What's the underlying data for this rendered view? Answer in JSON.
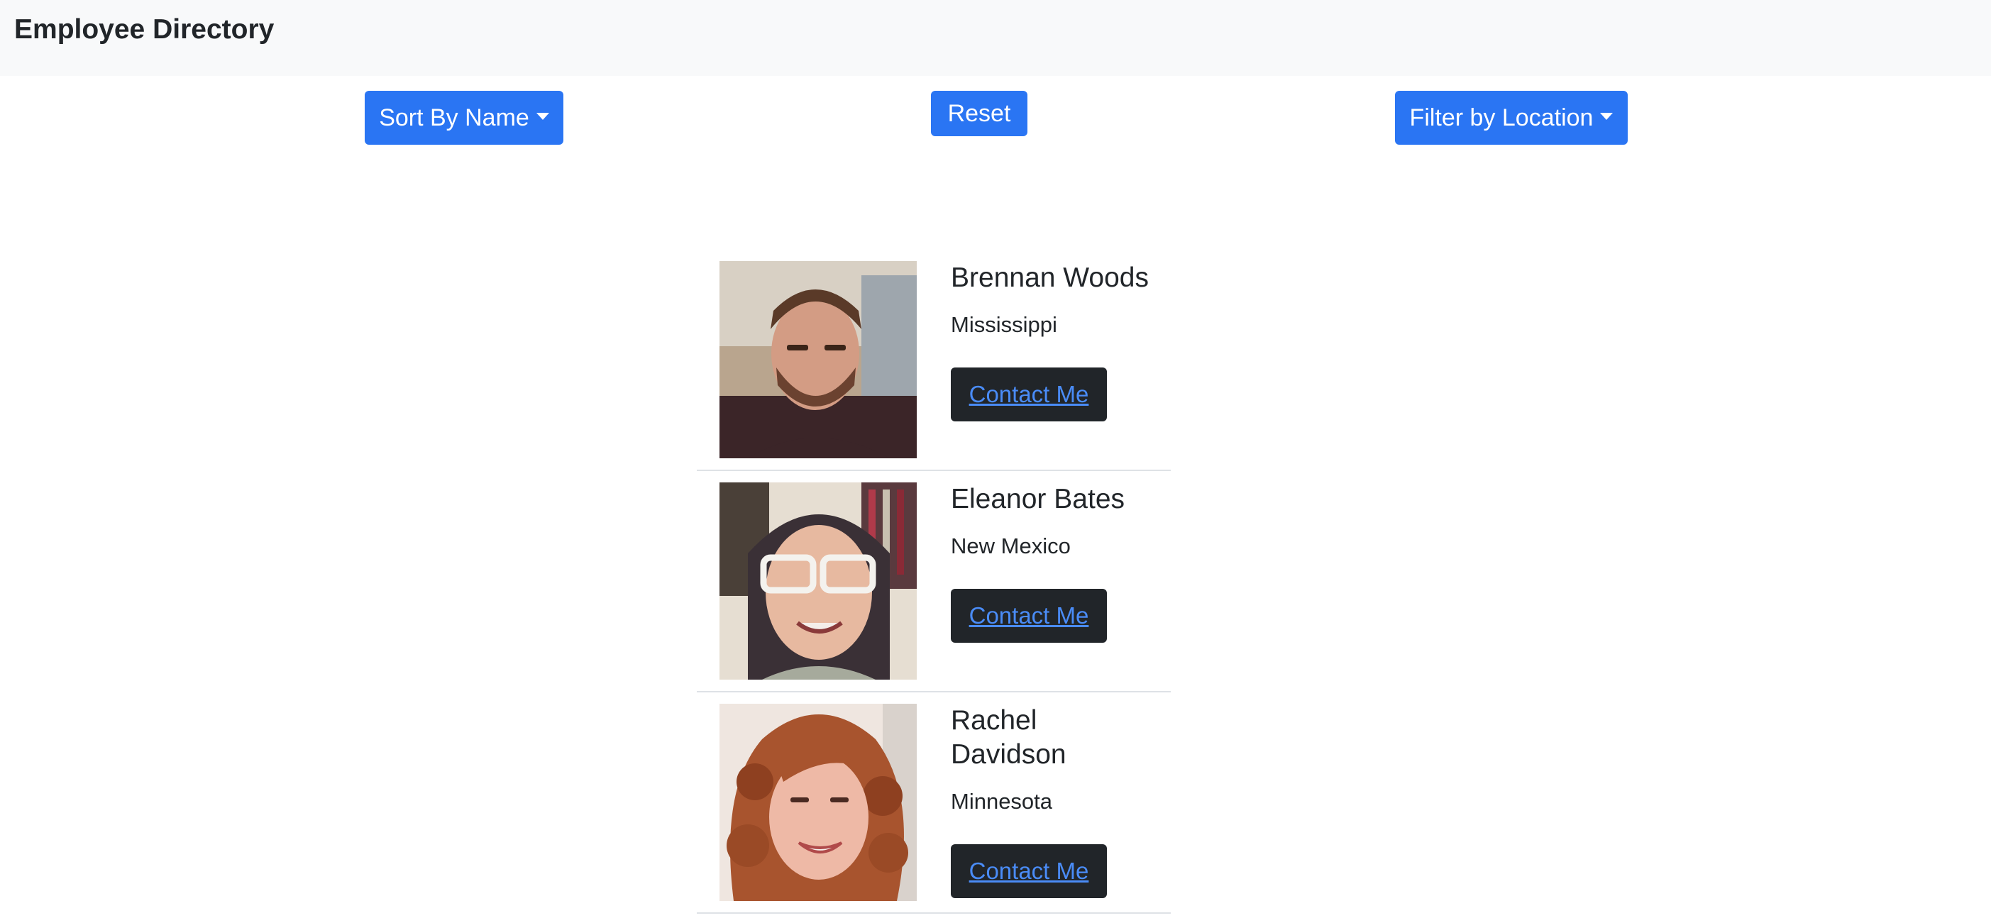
{
  "navbar": {
    "brand": "Employee Directory"
  },
  "controls": {
    "sort_label": "Sort By Name",
    "reset_label": "Reset",
    "filter_label": "Filter by Location"
  },
  "colors": {
    "primary": "#2a75f3",
    "dark": "#212529",
    "link": "#4a8cf7",
    "navbar_bg": "#f8f9fa"
  },
  "employees": [
    {
      "first": "Brennan",
      "last": "Woods",
      "location": "Mississippi",
      "contact_label": "Contact Me"
    },
    {
      "first": "Eleanor",
      "last": "Bates",
      "location": "New Mexico",
      "contact_label": "Contact Me"
    },
    {
      "first": "Rachel",
      "last": "Davidson",
      "location": "Minnesota",
      "contact_label": "Contact Me"
    }
  ]
}
